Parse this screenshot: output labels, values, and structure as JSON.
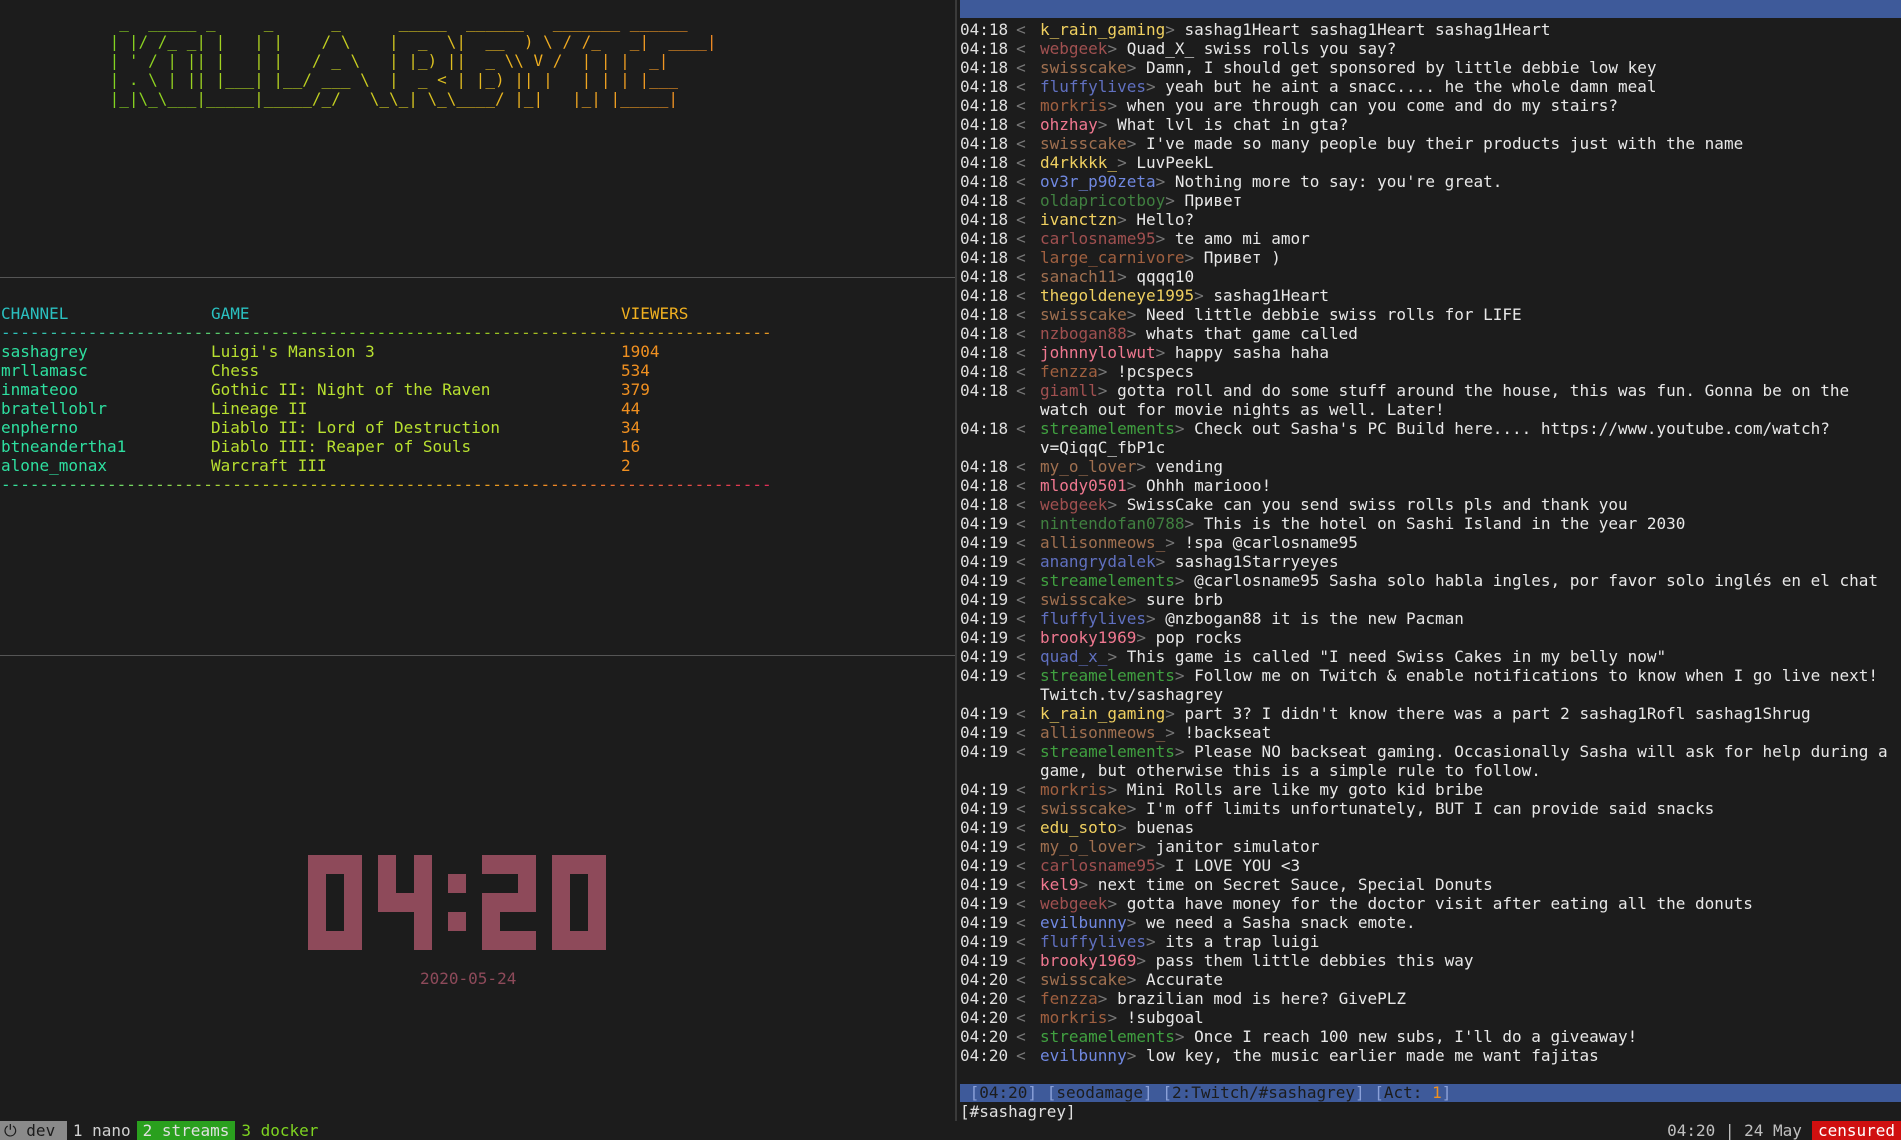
{
  "colors": {
    "background": "#1c1c1c",
    "status_blue": "#3e5a9a",
    "clock": "#8e4a5a",
    "header": "#2ac0c0",
    "channel": "#2ee0a0",
    "game": "#b8e030",
    "viewers": "#f09020",
    "tmux_active": "#2aa01e",
    "tmux_host": "#d01010"
  },
  "logo_ascii": "  _  _____ _     _      _      _____  ______   _______ ______\n | |/ /_ _| |   | |    / \\    |  _  \\|  __  ) \\ / /_   _|  ____|\n | ' / | || |   | |   / _ \\   | |_) ||  _ \\\\ V /  | | |  _|\n | . \\ | || |___| |__/ ___ \\  |  _ < | |_) || |   | | | |___\n |_|\\_\\___|_____|_____/_/   \\_\\_| \\_\\____/ |_|   |_| |_____|",
  "streams": {
    "headers": {
      "channel": "CHANNEL",
      "game": "GAME",
      "viewers": "VIEWERS"
    },
    "rule": "--------------------------------------------------------------------------------",
    "rows": [
      {
        "channel": "sashagrey",
        "game": "Luigi's Mansion 3",
        "viewers": "1904"
      },
      {
        "channel": "mrllamasc",
        "game": "Chess",
        "viewers": "534"
      },
      {
        "channel": "inmateoo",
        "game": "Gothic II: Night of the Raven",
        "viewers": "379"
      },
      {
        "channel": "bratelloblr",
        "game": "Lineage II",
        "viewers": "44"
      },
      {
        "channel": "enpherno",
        "game": "Diablo II: Lord of Destruction",
        "viewers": "34"
      },
      {
        "channel": "btneandertha1",
        "game": "Diablo III: Reaper of Souls",
        "viewers": "16"
      },
      {
        "channel": "alone_monax",
        "game": "Warcraft III",
        "viewers": "2"
      }
    ]
  },
  "clock": {
    "time": "04:20",
    "date": "2020-05-24"
  },
  "chat": {
    "messages": [
      {
        "t": "04:18",
        "u": "k_rain_gaming",
        "c": "#f0d060",
        "m": "sashag1Heart sashag1Heart sashag1Heart"
      },
      {
        "t": "04:18",
        "u": "webgeek",
        "c": "#a05050",
        "m": "Quad_X_ swiss rolls you say?"
      },
      {
        "t": "04:18",
        "u": "swisscake",
        "c": "#a07050",
        "m": "Damn, I should get sponsored by little debbie low key"
      },
      {
        "t": "04:18",
        "u": "fluffylives",
        "c": "#6070c0",
        "m": "yeah but he aint a snacc.... he the whole damn meal"
      },
      {
        "t": "04:18",
        "u": "morkris",
        "c": "#a06040",
        "m": "when you are through can you come and do my stairs?"
      },
      {
        "t": "04:18",
        "u": "ohzhay",
        "c": "#f07890",
        "m": "What lvl is chat in gta?"
      },
      {
        "t": "04:18",
        "u": "swisscake",
        "c": "#a07050",
        "m": "I've made so many people buy their products just with the name"
      },
      {
        "t": "04:18",
        "u": "d4rkkkk_",
        "c": "#f0d060",
        "m": "LuvPeekL"
      },
      {
        "t": "04:18",
        "u": "ov3r_p90zeta",
        "c": "#7088e0",
        "m": "Nothing more to say: you're great."
      },
      {
        "t": "04:18",
        "u": "oldapricotboy",
        "c": "#408040",
        "m": "Привет"
      },
      {
        "t": "04:18",
        "u": "ivanctzn",
        "c": "#f0d060",
        "m": "Hello?"
      },
      {
        "t": "04:18",
        "u": "carlosname95",
        "c": "#a05050",
        "m": "te amo mi amor"
      },
      {
        "t": "04:18",
        "u": "large_carnivore",
        "c": "#a06040",
        "m": "Привет )"
      },
      {
        "t": "04:18",
        "u": "sanach11",
        "c": "#a07050",
        "m": "qqqq10"
      },
      {
        "t": "04:18",
        "u": "thegoldeneye1995",
        "c": "#f0d060",
        "m": "sashag1Heart"
      },
      {
        "t": "04:18",
        "u": "swisscake",
        "c": "#a07050",
        "m": "Need little debbie swiss rolls for LIFE"
      },
      {
        "t": "04:18",
        "u": "nzbogan88",
        "c": "#a05050",
        "m": "whats that game called"
      },
      {
        "t": "04:18",
        "u": "johnnylolwut",
        "c": "#f07890",
        "m": "happy sasha haha"
      },
      {
        "t": "04:18",
        "u": "fenzza",
        "c": "#a06040",
        "m": "!pcspecs"
      },
      {
        "t": "04:18",
        "u": "giamll",
        "c": "#a05050",
        "m": "gotta roll and do some stuff around the house, this was fun. Gonna be on the watch out for movie nights as well. Later!"
      },
      {
        "t": "04:18",
        "u": "streamelements",
        "c": "#40a040",
        "m": "Check out Sasha's PC Build here.... https://www.youtube.com/watch?v=QiqqC_fbP1c"
      },
      {
        "t": "04:18",
        "u": "my_o_lover",
        "c": "#a07050",
        "m": "vending"
      },
      {
        "t": "04:18",
        "u": "mlody0501",
        "c": "#f07890",
        "m": "Ohhh mariooo!"
      },
      {
        "t": "04:18",
        "u": "webgeek",
        "c": "#a05050",
        "m": "SwissCake can you send swiss rolls pls and thank you"
      },
      {
        "t": "04:19",
        "u": "nintendofan0788",
        "c": "#408040",
        "m": "This is the hotel on Sashi Island in the year 2030"
      },
      {
        "t": "04:19",
        "u": "allisonmeows_",
        "c": "#a07050",
        "m": "!spa @carlosname95"
      },
      {
        "t": "04:19",
        "u": "anangrydalek",
        "c": "#6070c0",
        "m": "sashag1Starryeyes"
      },
      {
        "t": "04:19",
        "u": "streamelements",
        "c": "#40a040",
        "m": "@carlosname95 Sasha solo habla ingles, por favor solo inglés en el chat"
      },
      {
        "t": "04:19",
        "u": "swisscake",
        "c": "#a07050",
        "m": "sure brb"
      },
      {
        "t": "04:19",
        "u": "fluffylives",
        "c": "#6070c0",
        "m": "@nzbogan88 it is the new Pacman"
      },
      {
        "t": "04:19",
        "u": "brooky1969",
        "c": "#f07890",
        "m": "pop rocks"
      },
      {
        "t": "04:19",
        "u": "quad_x_",
        "c": "#6070c0",
        "m": "This game is called \"I need Swiss Cakes in my belly now\""
      },
      {
        "t": "04:19",
        "u": "streamelements",
        "c": "#40a040",
        "m": "Follow me on Twitch & enable notifications to know when I go live next! Twitch.tv/sashagrey"
      },
      {
        "t": "04:19",
        "u": "k_rain_gaming",
        "c": "#f0d060",
        "m": "part 3? I didn't know there was a part 2 sashag1Rofl sashag1Shrug"
      },
      {
        "t": "04:19",
        "u": "allisonmeows_",
        "c": "#a07050",
        "m": "!backseat"
      },
      {
        "t": "04:19",
        "u": "streamelements",
        "c": "#40a040",
        "m": "Please NO backseat gaming. Occasionally Sasha will ask for help during a game, but otherwise this is a simple rule to follow."
      },
      {
        "t": "04:19",
        "u": "morkris",
        "c": "#a06040",
        "m": "Mini Rolls are like my goto kid bribe"
      },
      {
        "t": "04:19",
        "u": "swisscake",
        "c": "#a07050",
        "m": "I'm off limits unfortunately, BUT I can provide said snacks"
      },
      {
        "t": "04:19",
        "u": "edu_soto",
        "c": "#f0d060",
        "m": "buenas"
      },
      {
        "t": "04:19",
        "u": "my_o_lover",
        "c": "#a07050",
        "m": "janitor simulator"
      },
      {
        "t": "04:19",
        "u": "carlosname95",
        "c": "#a05050",
        "m": "I LOVE YOU <3"
      },
      {
        "t": "04:19",
        "u": "kel9",
        "c": "#f07890",
        "m": "next time on Secret Sauce, Special Donuts"
      },
      {
        "t": "04:19",
        "u": "webgeek",
        "c": "#a05050",
        "m": "gotta have money for the doctor visit after eating all the donuts"
      },
      {
        "t": "04:19",
        "u": "evilbunny",
        "c": "#7088e0",
        "m": "we need a Sasha snack emote."
      },
      {
        "t": "04:19",
        "u": "fluffylives",
        "c": "#6070c0",
        "m": "its a trap luigi"
      },
      {
        "t": "04:19",
        "u": "brooky1969",
        "c": "#f07890",
        "m": "pass them little debbies this way"
      },
      {
        "t": "04:20",
        "u": "swisscake",
        "c": "#a07050",
        "m": "Accurate"
      },
      {
        "t": "04:20",
        "u": "fenzza",
        "c": "#a06040",
        "m": "brazilian mod is here? GivePLZ"
      },
      {
        "t": "04:20",
        "u": "morkris",
        "c": "#a06040",
        "m": "!subgoal"
      },
      {
        "t": "04:20",
        "u": "streamelements",
        "c": "#40a040",
        "m": "Once I reach 100 new subs, I'll do a giveaway!"
      },
      {
        "t": "04:20",
        "u": "evilbunny",
        "c": "#7088e0",
        "m": "low key, the music earlier made me want fajitas"
      }
    ],
    "status": {
      "time": "04:20",
      "nick": "seodamage",
      "window": "2:Twitch/#sashagrey",
      "act_label": "Act:",
      "act_value": "1"
    },
    "input_channel": "[#sashagrey]"
  },
  "tmux": {
    "session": "dev",
    "session_icon": "plug-icon",
    "windows": [
      {
        "label": "1 nano",
        "state": "normal"
      },
      {
        "label": "2 streams",
        "state": "active"
      },
      {
        "label": "3 docker",
        "state": "activity"
      }
    ],
    "clock": "04:20 | 24 May",
    "host": "censured"
  }
}
